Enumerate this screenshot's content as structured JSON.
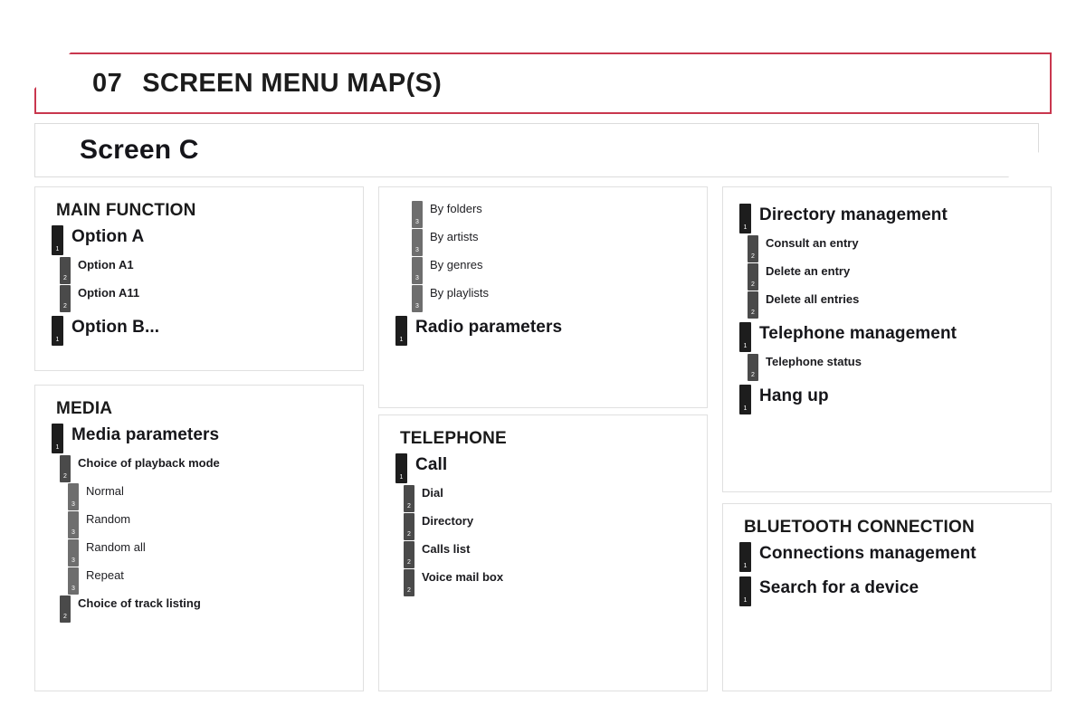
{
  "page": {
    "background": "#ffffff",
    "accent_color": "#c9374e",
    "panel_border_color": "#e0e0e0"
  },
  "header": {
    "chapter_number": "07",
    "chapter_title": "SCREEN MENU MAP(S)",
    "border_color": "#c9374e"
  },
  "screen_bar": {
    "label": "Screen C"
  },
  "legend_levels": {
    "level1_color": "#1d1d1d",
    "level2_color": "#4a4a4a",
    "level3_color": "#6e6e6e"
  },
  "columns": [
    {
      "id": "column-1",
      "panels": [
        {
          "id": "main-function-panel",
          "heading": "MAIN FUNCTION",
          "rows": [
            {
              "level": "1",
              "label": "Option A"
            },
            {
              "level": "2",
              "label": "Option A1"
            },
            {
              "level": "2",
              "label": "Option A11"
            },
            {
              "level": "1",
              "label": "Option B..."
            }
          ]
        },
        {
          "id": "media-panel",
          "heading": "MEDIA",
          "rows": [
            {
              "level": "1",
              "label": "Media parameters"
            },
            {
              "level": "2",
              "label": "Choice of playback mode"
            },
            {
              "level": "3",
              "label": "Normal"
            },
            {
              "level": "3",
              "label": "Random"
            },
            {
              "level": "3",
              "label": "Random all"
            },
            {
              "level": "3",
              "label": "Repeat"
            },
            {
              "level": "2",
              "label": "Choice of track listing"
            }
          ]
        }
      ]
    },
    {
      "id": "column-2",
      "panels": [
        {
          "id": "media-continued-panel",
          "heading": "",
          "rows": [
            {
              "level": "3",
              "label": "By folders"
            },
            {
              "level": "3",
              "label": "By artists"
            },
            {
              "level": "3",
              "label": "By genres"
            },
            {
              "level": "3",
              "label": "By playlists"
            },
            {
              "level": "1",
              "label": "Radio parameters"
            }
          ]
        },
        {
          "id": "telephone-panel",
          "heading": "TELEPHONE",
          "rows": [
            {
              "level": "1",
              "label": "Call"
            },
            {
              "level": "2",
              "label": "Dial"
            },
            {
              "level": "2",
              "label": "Directory"
            },
            {
              "level": "2",
              "label": "Calls list"
            },
            {
              "level": "2",
              "label": "Voice mail box"
            }
          ]
        }
      ]
    },
    {
      "id": "column-3",
      "panels": [
        {
          "id": "telephone-continued-panel",
          "heading": "",
          "rows": [
            {
              "level": "1",
              "label": "Directory management"
            },
            {
              "level": "2",
              "label": "Consult an entry"
            },
            {
              "level": "2",
              "label": "Delete an entry"
            },
            {
              "level": "2",
              "label": "Delete all entries"
            },
            {
              "level": "1",
              "label": "Telephone management"
            },
            {
              "level": "2",
              "label": "Telephone status"
            },
            {
              "level": "1",
              "label": "Hang up"
            }
          ]
        },
        {
          "id": "bluetooth-panel",
          "heading": "BLUETOOTH CONNECTION",
          "rows": [
            {
              "level": "1",
              "label": "Connections management"
            },
            {
              "level": "1",
              "label": "Search for a device"
            }
          ]
        }
      ]
    }
  ]
}
